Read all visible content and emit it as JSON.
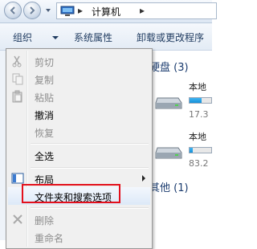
{
  "window": {
    "breadcrumb": "计算机",
    "chevron": "▸"
  },
  "toolbar": {
    "organize_label": "组织",
    "system_properties_label": "系统属性",
    "uninstall_label": "卸载或更改程序"
  },
  "content": {
    "group_hard_disks": "硬盘 (3)",
    "drive1_name": "本地",
    "drive1_size": "17.3",
    "drive1_used_fraction": 0.55,
    "drive2_name": "本地",
    "drive2_size": "83.2",
    "drive2_used_fraction": 0.15,
    "group_other": "其他 (1)"
  },
  "menu": {
    "items": [
      {
        "label": "剪切",
        "icon": "scissors-icon",
        "enabled": false
      },
      {
        "label": "复制",
        "icon": "copy-icon",
        "enabled": false
      },
      {
        "label": "粘贴",
        "icon": "paste-icon",
        "enabled": false
      },
      {
        "label": "撤消",
        "icon": "",
        "enabled": true
      },
      {
        "label": "恢复",
        "icon": "",
        "enabled": false
      },
      {
        "label": "全选",
        "icon": "",
        "enabled": true
      },
      {
        "label": "布局",
        "icon": "layout-icon",
        "enabled": true,
        "submenu": true
      },
      {
        "label": "文件夹和搜索选项",
        "icon": "",
        "enabled": true,
        "highlighted": true
      },
      {
        "label": "删除",
        "icon": "delete-icon",
        "enabled": false
      },
      {
        "label": "重命名",
        "icon": "",
        "enabled": false
      }
    ]
  },
  "colors": {
    "highlight_border": "#e3101c",
    "bar_fill": "#1590d8",
    "link_text": "#1a3b6e"
  }
}
